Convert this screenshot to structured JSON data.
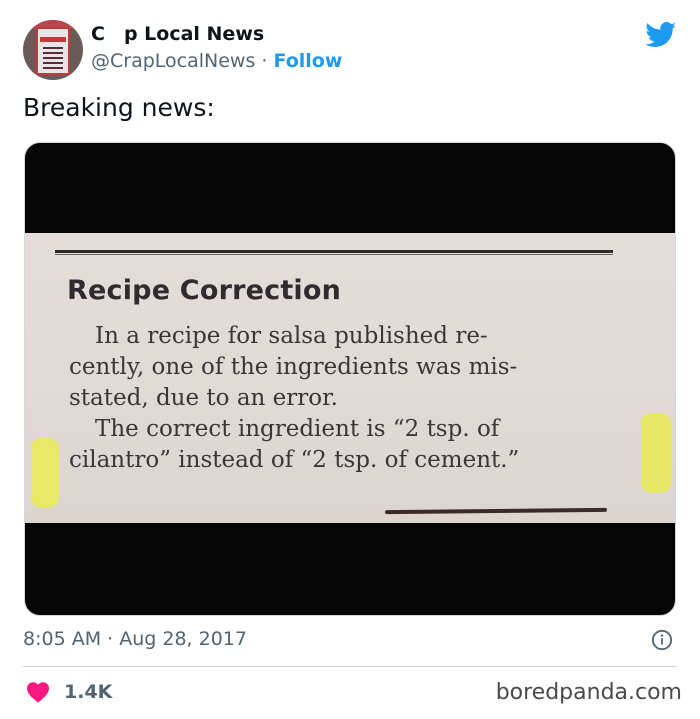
{
  "tweet": {
    "author_name": "C p Local News",
    "author_handle": "@CrapLocalNews",
    "separator": "·",
    "follow_label": "Follow",
    "text": "Breaking news:",
    "time": "8:05 AM · Aug 28, 2017",
    "like_count": "1.4K"
  },
  "clipping": {
    "title": "Recipe Correction",
    "lines": [
      "In a recipe for salsa published  re-",
      "cently, one of the ingredients was mis-",
      "stated, due to an error.",
      "The correct ingredient is “2 tsp. of",
      "cilantro” instead of “2 tsp. of cement.”"
    ]
  },
  "watermark": "boredpanda.com",
  "colors": {
    "accent": "#1d9bf0",
    "like": "#f91880",
    "muted": "#536471"
  },
  "icons": {
    "brand": "twitter-bird-icon",
    "info": "info-icon",
    "like": "heart-icon"
  }
}
